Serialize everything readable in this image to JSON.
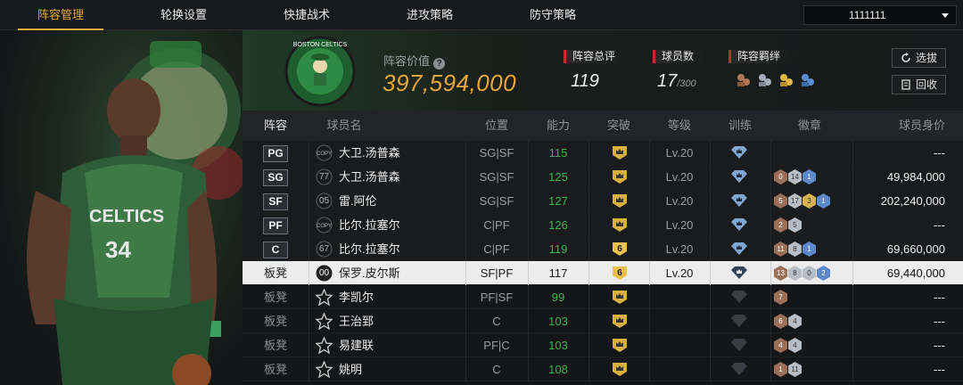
{
  "tabs": [
    {
      "label": "阵容管理",
      "active": true
    },
    {
      "label": "轮换设置",
      "active": false
    },
    {
      "label": "快捷战术",
      "active": false
    },
    {
      "label": "进攻策略",
      "active": false
    },
    {
      "label": "防守策略",
      "active": false
    }
  ],
  "account_dropdown": {
    "value": "1111111"
  },
  "header": {
    "team_logo_text": "BOSTON CELTICS",
    "value_label": "阵容价值",
    "value": "397,594,000",
    "overall_label": "阵容总评",
    "overall": "119",
    "players_label": "球员数",
    "players": "17",
    "players_max": "/300",
    "bond_label": "阵容羁绊",
    "bond_icons": [
      "bond-bronze-icon",
      "bond-silver-icon",
      "bond-gold-icon",
      "bond-blue-icon"
    ],
    "btn_select": "选拔",
    "btn_recycle": "回收"
  },
  "columns": [
    "阵容",
    "球员名",
    "位置",
    "能力",
    "突破",
    "等级",
    "训练",
    "徽章",
    "球员身价"
  ],
  "rows": [
    {
      "slot": "PG",
      "starter": true,
      "num": "COPY",
      "name": "大卫.汤普森",
      "pos": "SG|SF",
      "ability": "115",
      "breakthrough": "",
      "level": "Lv.20",
      "badges": [],
      "price": "---",
      "selected": false
    },
    {
      "slot": "SG",
      "starter": true,
      "num": "77",
      "name": "大卫.汤普森",
      "pos": "SG|SF",
      "ability": "125",
      "breakthrough": "",
      "level": "Lv.20",
      "badges": [
        [
          "bronze",
          "0"
        ],
        [
          "silver",
          "14"
        ],
        [
          "blue",
          "1"
        ]
      ],
      "price": "49,984,000",
      "selected": false
    },
    {
      "slot": "SF",
      "starter": true,
      "num": "05",
      "name": "雷.阿伦",
      "pos": "SG|SF",
      "ability": "127",
      "breakthrough": "",
      "level": "Lv.20",
      "badges": [
        [
          "bronze",
          "5"
        ],
        [
          "silver",
          "17"
        ],
        [
          "gold",
          "3"
        ],
        [
          "blue",
          "1"
        ]
      ],
      "price": "202,240,000",
      "selected": false
    },
    {
      "slot": "PF",
      "starter": true,
      "num": "COPY",
      "name": "比尔.拉塞尔",
      "pos": "C|PF",
      "ability": "126",
      "breakthrough": "",
      "level": "Lv.20",
      "badges": [
        [
          "bronze",
          "2"
        ],
        [
          "silver",
          "5"
        ]
      ],
      "price": "---",
      "selected": false
    },
    {
      "slot": "C",
      "starter": true,
      "num": "67",
      "name": "比尔.拉塞尔",
      "pos": "C|PF",
      "ability": "119",
      "breakthrough": "6",
      "level": "Lv.20",
      "badges": [
        [
          "bronze",
          "11"
        ],
        [
          "silver",
          "8"
        ],
        [
          "blue",
          "1"
        ]
      ],
      "price": "69,660,000",
      "selected": false
    },
    {
      "slot": "板凳",
      "starter": false,
      "num": "00",
      "name": "保罗.皮尔斯",
      "pos": "SF|PF",
      "ability": "117",
      "breakthrough": "6",
      "level": "Lv.20",
      "badges": [
        [
          "bronze",
          "13"
        ],
        [
          "silver",
          "8"
        ],
        [
          "silver",
          "0"
        ],
        [
          "blue",
          "2"
        ]
      ],
      "price": "69,440,000",
      "selected": true
    },
    {
      "slot": "板凳",
      "starter": false,
      "num": "",
      "name": "李凯尔",
      "pos": "PF|SF",
      "ability": "99",
      "breakthrough": "",
      "level": "",
      "badges": [
        [
          "bronze",
          "7"
        ]
      ],
      "price": "---",
      "selected": false
    },
    {
      "slot": "板凳",
      "starter": false,
      "num": "",
      "name": "王治郅",
      "pos": "C",
      "ability": "103",
      "breakthrough": "",
      "level": "",
      "badges": [
        [
          "bronze",
          "6"
        ],
        [
          "silver",
          "4"
        ]
      ],
      "price": "---",
      "selected": false
    },
    {
      "slot": "板凳",
      "starter": false,
      "num": "",
      "name": "易建联",
      "pos": "PF|C",
      "ability": "103",
      "breakthrough": "",
      "level": "",
      "badges": [
        [
          "bronze",
          "4"
        ],
        [
          "silver",
          "4"
        ]
      ],
      "price": "---",
      "selected": false
    },
    {
      "slot": "板凳",
      "starter": false,
      "num": "",
      "name": "姚明",
      "pos": "C",
      "ability": "108",
      "breakthrough": "",
      "level": "",
      "badges": [
        [
          "bronze",
          "1"
        ],
        [
          "silver",
          "11"
        ]
      ],
      "price": "---",
      "selected": false
    }
  ],
  "colors": {
    "accent": "#e5a83a",
    "ability_green": "#3eb64f",
    "stat_red": "#c0302a"
  }
}
